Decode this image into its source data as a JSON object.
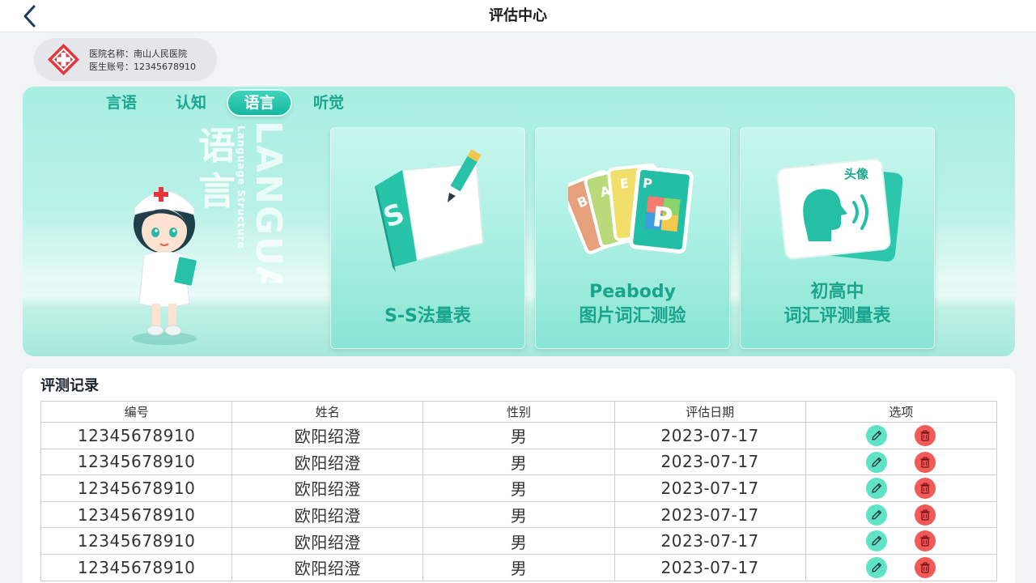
{
  "header": {
    "title": "评估中心"
  },
  "hospital": {
    "name_label": "医院名称：南山人民医院",
    "account_label": "医生账号：12345678910"
  },
  "tabs": [
    {
      "label": "言语",
      "active": false
    },
    {
      "label": "认知",
      "active": false
    },
    {
      "label": "语言",
      "active": true
    },
    {
      "label": "听觉",
      "active": false
    }
  ],
  "banner": {
    "big_text_cn": "语言",
    "big_text_en": "LANGUA",
    "sub_text_en": "Language Structure"
  },
  "cards": [
    {
      "art_icon": "s-s-book-icon",
      "label_line1": "S-S法量表",
      "label_line2": ""
    },
    {
      "art_icon": "peabody-cards-icon",
      "art_letters": [
        "B",
        "A",
        "E",
        "P"
      ],
      "label_line1": "Peabody",
      "label_line2": "图片词汇测验"
    },
    {
      "art_icon": "head-audio-card-icon",
      "art_text": "头像",
      "label_line1": "初高中",
      "label_line2": "词汇评测量表"
    }
  ],
  "records": {
    "title": "评测记录",
    "columns": [
      "编号",
      "姓名",
      "性别",
      "评估日期",
      "选项"
    ],
    "rows": [
      {
        "id": "12345678910",
        "name": "欧阳绍澄",
        "gender": "男",
        "date": "2023-07-17"
      },
      {
        "id": "12345678910",
        "name": "欧阳绍澄",
        "gender": "男",
        "date": "2023-07-17"
      },
      {
        "id": "12345678910",
        "name": "欧阳绍澄",
        "gender": "男",
        "date": "2023-07-17"
      },
      {
        "id": "12345678910",
        "name": "欧阳绍澄",
        "gender": "男",
        "date": "2023-07-17"
      },
      {
        "id": "12345678910",
        "name": "欧阳绍澄",
        "gender": "男",
        "date": "2023-07-17"
      },
      {
        "id": "12345678910",
        "name": "欧阳绍澄",
        "gender": "男",
        "date": "2023-07-17"
      }
    ],
    "action_icons": [
      "pencil-icon",
      "trash-icon"
    ]
  },
  "colors": {
    "accent": "#19a48d",
    "tab_active": "#17b79f",
    "edit": "#5fe3c6",
    "delete": "#f25a5a"
  }
}
